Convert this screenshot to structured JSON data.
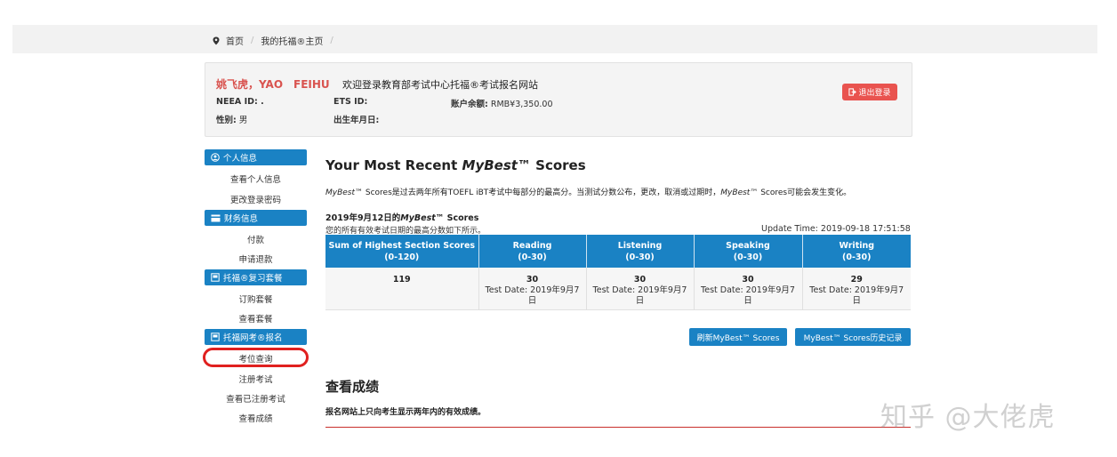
{
  "breadcrumb": [
    "首页",
    "我的托福®主页"
  ],
  "user": {
    "name": "姚飞虎，YAO　FEIHU",
    "welcome": "欢迎登录教育部考试中心托福®考试报名网站",
    "neea_id_label": "NEEA ID: .",
    "ets_id_label": "ETS ID:",
    "balance_label": "账户余额:",
    "balance_value": "RMB¥3,350.00",
    "gender_label": "性别:",
    "gender_value": "男",
    "dob_label": "出生年月日:",
    "logout_label": "退出登录"
  },
  "sidebar": {
    "sections": [
      {
        "title": "个人信息",
        "icon": "user-circle-icon",
        "items": [
          "查看个人信息",
          "更改登录密码"
        ]
      },
      {
        "title": "财务信息",
        "icon": "credit-card-icon",
        "items": [
          "付款",
          "申请退款"
        ]
      },
      {
        "title": "托福®复习套餐",
        "icon": "book-icon",
        "items": [
          "订购套餐",
          "查看套餐"
        ]
      },
      {
        "title": "托福网考®报名",
        "icon": "book-icon",
        "items": [
          "考位查询",
          "注册考试",
          "查看已注册考试",
          "查看成绩"
        ]
      }
    ],
    "highlighted_item": "考位查询",
    "highlight_color": "#e0201f"
  },
  "main": {
    "title_prefix": "Your Most Recent ",
    "title_em": "MyBest™",
    "title_suffix": " Scores",
    "description_em": "MyBest™",
    "description_1": " Scores是过去两年所有TOEFL iBT考试中每部分的最高分。当测试分数公布，更改，取消或过期时，",
    "description_em2": "MyBest™",
    "description_2": " Scores可能会发生变化。",
    "sub_heading_prefix": "2019年9月12日的",
    "sub_heading_em": "MyBest™",
    "sub_heading_suffix": " Scores",
    "sub_desc": "您的所有有效考试日期的最高分数如下所示。",
    "update_time": "Update Time: 2019-09-18 17:51:58",
    "table": {
      "headers": [
        {
          "name": "Sum of Highest Section Scores",
          "range": "(0-120)"
        },
        {
          "name": "Reading",
          "range": "(0-30)"
        },
        {
          "name": "Listening",
          "range": "(0-30)"
        },
        {
          "name": "Speaking",
          "range": "(0-30)"
        },
        {
          "name": "Writing",
          "range": "(0-30)"
        }
      ],
      "row": [
        {
          "value": "119",
          "date1": "",
          "date2": ""
        },
        {
          "value": "30",
          "date1": "Test Date: 2019年9月7",
          "date2": "日"
        },
        {
          "value": "30",
          "date1": "Test Date: 2019年9月7",
          "date2": "日"
        },
        {
          "value": "30",
          "date1": "Test Date: 2019年9月7",
          "date2": "日"
        },
        {
          "value": "29",
          "date1": "Test Date: 2019年9月7",
          "date2": "日"
        }
      ]
    },
    "refresh_button": "刷新MyBest™ Scores",
    "history_button": "MyBest™ Scores历史记录",
    "scores_title": "查看成绩",
    "scores_note": "报名网站上只向考生显示两年内的有效成绩。"
  },
  "watermark": "知乎 @大佬虎",
  "colors": {
    "accent": "#1a82c4",
    "danger": "#e9534f",
    "name": "#d9534f"
  }
}
